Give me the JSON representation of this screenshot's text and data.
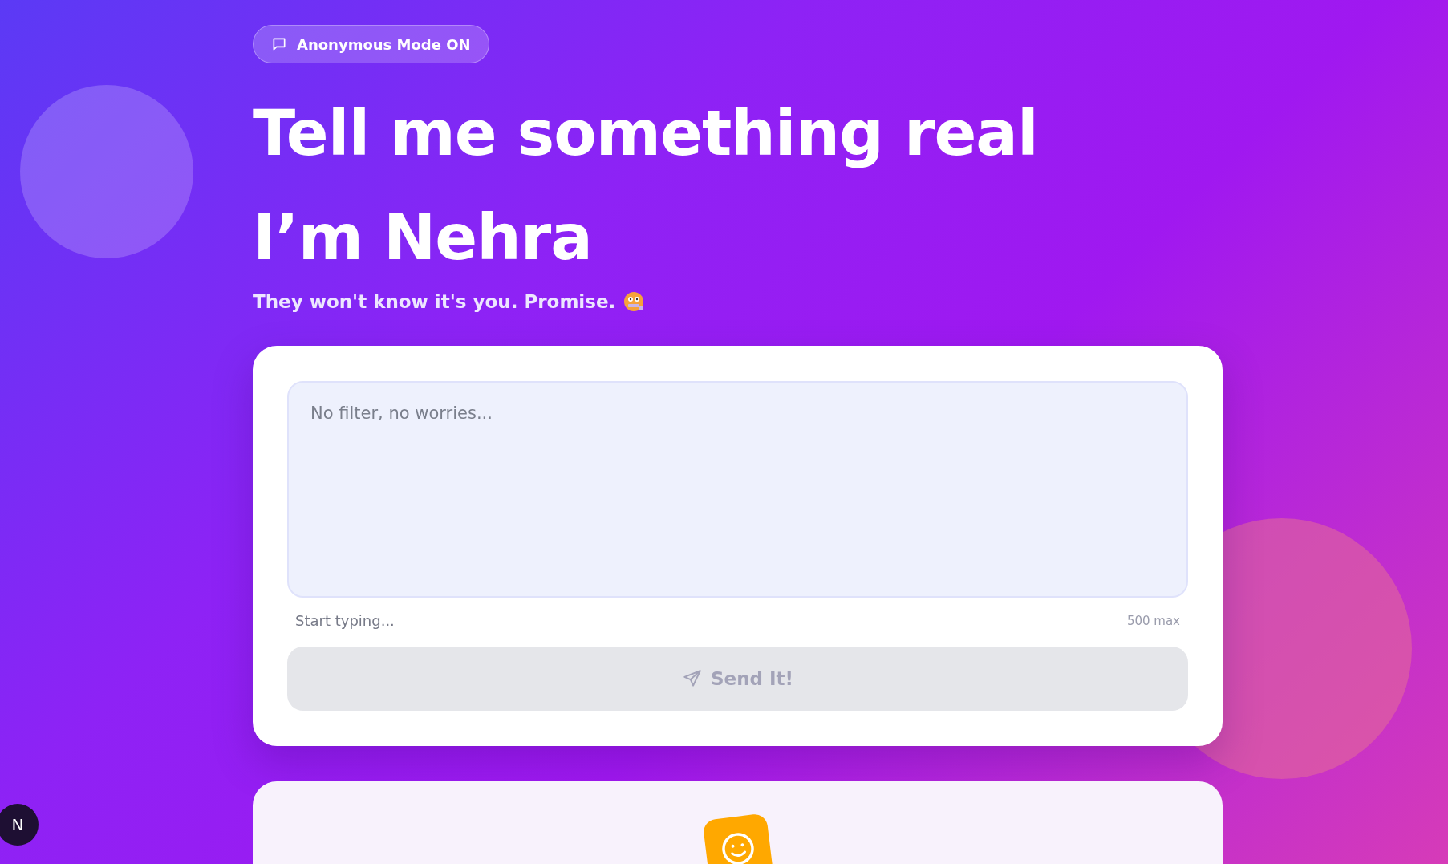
{
  "badge": {
    "label": "Anonymous Mode ON"
  },
  "heading": {
    "lines": [
      "Tell me something real",
      "I’m Nehra"
    ]
  },
  "subtitle": "They won't know it's you. Promise.",
  "form": {
    "message": {
      "placeholder": "No filter, no worries..."
    },
    "hint": "Start typing...",
    "limit": "500 max",
    "submit": {
      "label": "Send It!",
      "disabled": true
    }
  },
  "dev_badge": {
    "label": "N"
  }
}
